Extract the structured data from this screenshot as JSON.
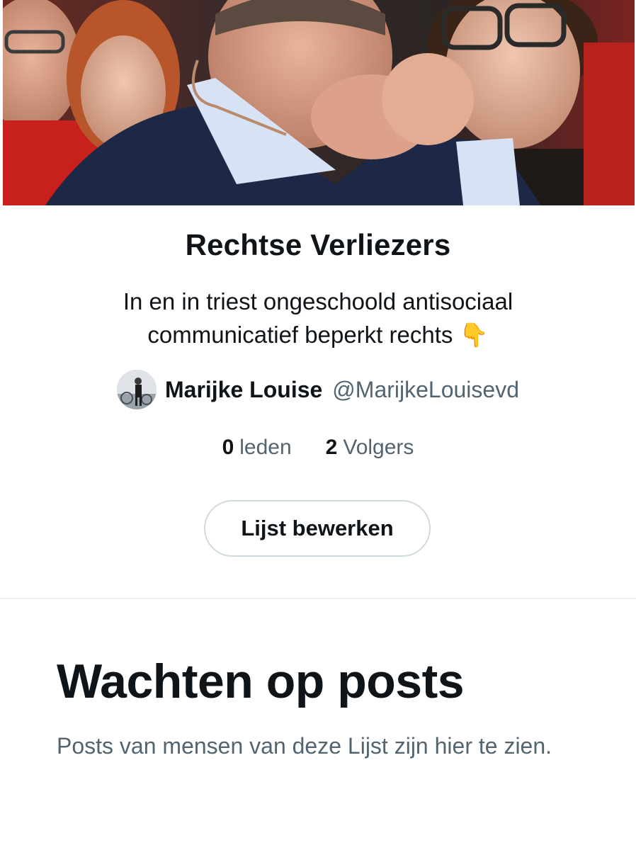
{
  "list": {
    "banner_alt": "List banner photo",
    "title": "Rechtse Verliezers",
    "description": "In en in triest ongeschoold antisociaal communicatief beperkt rechts 👇",
    "owner": {
      "name": "Marijke Louise",
      "handle": "@MarijkeLouisevd"
    },
    "stats": {
      "members_count": "0",
      "members_label": "leden",
      "followers_count": "2",
      "followers_label": "Volgers"
    },
    "edit_button_label": "Lijst bewerken"
  },
  "empty_state": {
    "title": "Wachten op posts",
    "text": "Posts van mensen van deze Lijst zijn hier te zien."
  },
  "colors": {
    "text_primary": "#0f1419",
    "text_secondary": "#536471",
    "border": "#cfd9de",
    "divider": "#eff3f4"
  }
}
